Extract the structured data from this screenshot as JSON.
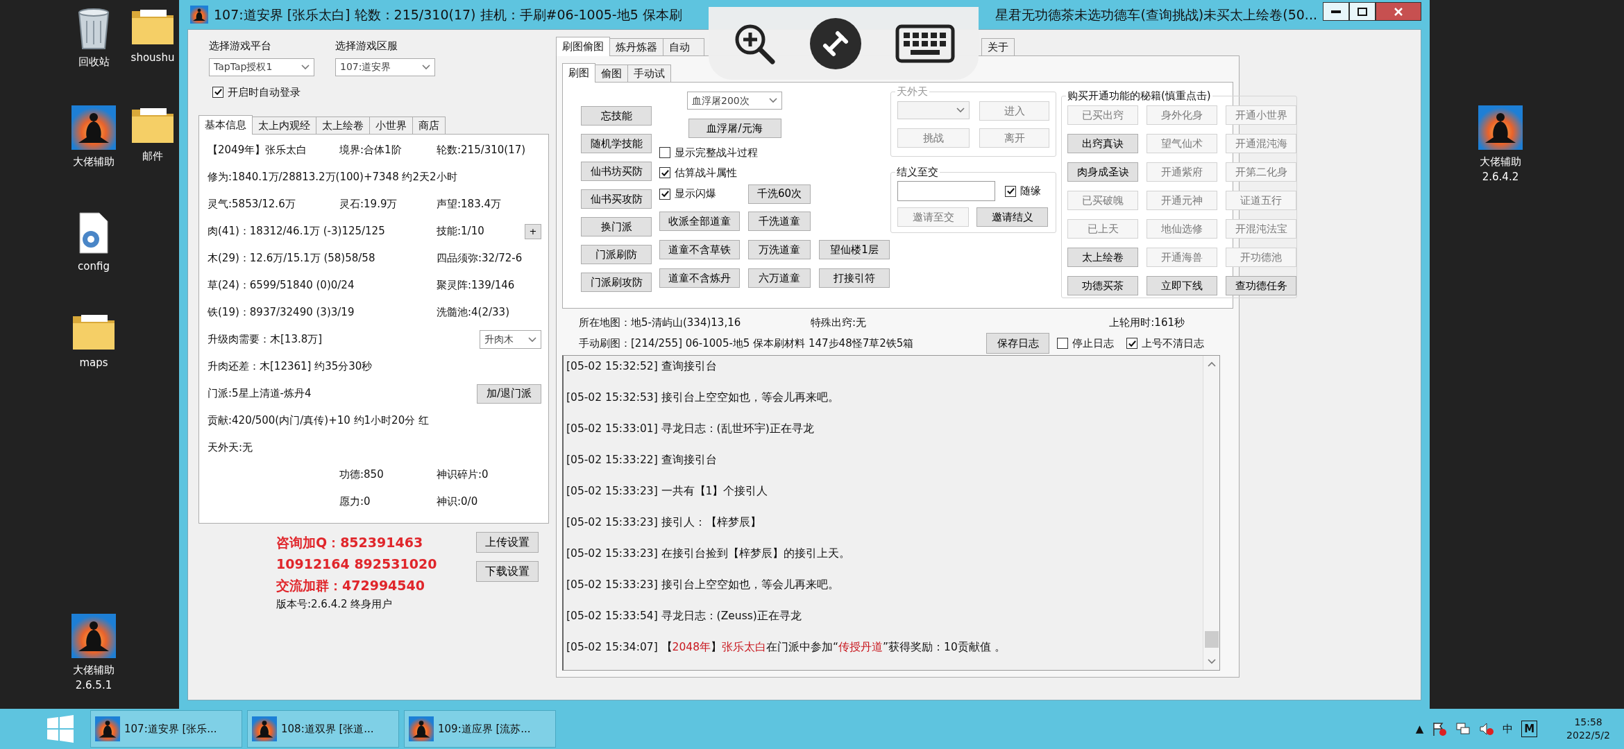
{
  "desktop_icons": [
    {
      "kind": "recycle",
      "label": "回收站"
    },
    {
      "kind": "folder",
      "label": "shoushu"
    },
    {
      "kind": "app",
      "label": "大佬辅助"
    },
    {
      "kind": "folder",
      "label": "邮件"
    },
    {
      "kind": "config",
      "label": "config"
    },
    {
      "kind": "folder",
      "label": "maps"
    },
    {
      "kind": "app",
      "label": "大佬辅助",
      "version": "2.6.5.1"
    },
    {
      "kind": "app",
      "label": "大佬辅助",
      "version": "2.6.4.2"
    }
  ],
  "window": {
    "title": "107:道安界 [张乐太白] 轮数：215/310(17) 挂机：手刷#06-1005-地5 保本刷",
    "title_end": "星君无功德茶未选功德车(查询挑战)未买太上绘卷(50..."
  },
  "login": {
    "platform_label": "选择游戏平台",
    "platform": "TapTap授权1",
    "server_label": "选择游戏区服",
    "server": "107:道安界",
    "auto_login": {
      "label": "开启时自动登录",
      "checked": true
    }
  },
  "info_tabs": [
    {
      "label": "基本信息",
      "selected": true
    },
    {
      "label": "太上内观经",
      "selected": false
    },
    {
      "label": "太上绘卷",
      "selected": false
    },
    {
      "label": "小世界",
      "selected": false
    },
    {
      "label": "商店",
      "selected": false
    }
  ],
  "info_rows": [
    {
      "left": "【2049年】张乐太白",
      "middle": "境界:合体1阶",
      "right": "轮数:215/310(17)"
    },
    {
      "full": "修为:1840.1万/28813.2万(100)+7348 约2天2小时"
    },
    {
      "left": "灵气:5853/12.6万",
      "middle": "灵石:19.9万",
      "right": "声望:183.4万"
    },
    {
      "wide": "肉(41)：18312/46.1万 (-3)125/125",
      "right": "技能:1/10",
      "button": "+"
    },
    {
      "wide": "木(29)：12.6万/15.1万 (58)58/58",
      "right": "四品须弥:32/72-6"
    },
    {
      "wide": "草(24)：6599/51840 (0)0/24",
      "right": "聚灵阵:139/146"
    },
    {
      "wide": "铁(19)：8937/32490 (3)3/19",
      "right": "洗髓池:4(2/33)"
    },
    {
      "full": "升级肉需要：木[13.8万]",
      "dropdown": "升肉木"
    },
    {
      "full": "升肉还差：木[12361] 约35分30秒"
    },
    {
      "full": "门派:5星上清道-炼丹4",
      "button": "加/退门派"
    },
    {
      "full": "贡献:420/500(内门/真传)+10 约1小时20分 红"
    },
    {
      "full": "天外天:无"
    },
    {
      "middle": "功德:850",
      "right": "神识碎片:0"
    },
    {
      "middle": "愿力:0",
      "right": "神识:0/0"
    }
  ],
  "contact_lines": [
    "咨询加Q：852391463",
    "10912164  892531020",
    "交流加群：472994540"
  ],
  "version": "版本号:2.6.4.2 终身用户",
  "side_buttons": [
    "上传设置",
    "下载设置"
  ],
  "main_tabs": [
    {
      "label": "刷图偷图",
      "selected": true
    },
    {
      "label": "炼丹炼器",
      "selected": false
    },
    {
      "label": "自动",
      "selected": false
    },
    {
      "label": "关于",
      "selected": false
    }
  ],
  "sub_tabs": [
    {
      "label": "刷图",
      "selected": true
    },
    {
      "label": "偷图",
      "selected": false
    },
    {
      "label": "手动试",
      "selected": false
    }
  ],
  "skill_buttons": [
    "忘技能",
    "随机学技能",
    "仙书坊买防",
    "仙书买攻防",
    "换门派",
    "门派刷防",
    "门派刷攻防"
  ],
  "battle_select": "血浮屠200次",
  "battle_button": "血浮屠/元海",
  "options": [
    {
      "label": "显示完整战斗过程",
      "checked": false
    },
    {
      "label": "估算战斗属性",
      "checked": true
    },
    {
      "label": "显示闪爆",
      "checked": true
    }
  ],
  "wash_button": "千洗60次",
  "action_grid": [
    [
      "收派全部道童",
      "千洗道童"
    ],
    [
      "道童不含草铁",
      "万洗道童",
      "望仙楼1层"
    ],
    [
      "道童不含炼丹",
      "六万道童",
      "打接引符"
    ]
  ],
  "tianwaitian": {
    "title": "天外天",
    "disabled": true,
    "buttons": [
      "进入",
      "挑战",
      "离开"
    ]
  },
  "jieyi": {
    "title": "结义至交",
    "random": {
      "label": "随缘",
      "checked": true
    },
    "buttons": [
      {
        "label": "邀请至交",
        "disabled": true
      },
      {
        "label": "邀请结义",
        "disabled": false
      }
    ]
  },
  "secrets": {
    "title": "购买开通功能的秘籍(慎重点击)",
    "buttons": [
      {
        "label": "已买出窍",
        "disabled": true
      },
      {
        "label": "身外化身",
        "disabled": true
      },
      {
        "label": "开通小世界",
        "disabled": true
      },
      {
        "label": "出窍真诀",
        "disabled": false
      },
      {
        "label": "望气仙术",
        "disabled": true
      },
      {
        "label": "开通混沌海",
        "disabled": true
      },
      {
        "label": "肉身成圣诀",
        "disabled": false
      },
      {
        "label": "开通紫府",
        "disabled": true
      },
      {
        "label": "开第二化身",
        "disabled": true
      },
      {
        "label": "已买破魄",
        "disabled": true
      },
      {
        "label": "开通元神",
        "disabled": true
      },
      {
        "label": "证道五行",
        "disabled": true
      },
      {
        "label": "已上天",
        "disabled": true
      },
      {
        "label": "地仙选修",
        "disabled": true
      },
      {
        "label": "开混沌法宝",
        "disabled": true
      },
      {
        "label": "太上绘卷",
        "disabled": false
      },
      {
        "label": "开通海兽",
        "disabled": true
      },
      {
        "label": "开功德池",
        "disabled": true
      },
      {
        "label": "功德买茶",
        "disabled": false
      },
      {
        "label": "立即下线",
        "disabled": false
      },
      {
        "label": "查功德任务",
        "disabled": false
      }
    ]
  },
  "status": {
    "map": "所在地图：地5-清屿山(334)13,16",
    "special": "特殊出窍:无",
    "last_round": "上轮用时:161秒",
    "manual": "手动刷图：[214/255] 06-1005-地5 保本刷材料 147步48怪7草2铁5箱"
  },
  "log_controls": {
    "save": "保存日志",
    "stop": {
      "label": "停止日志",
      "checked": false
    },
    "keep": {
      "label": "上号不清日志",
      "checked": true
    }
  },
  "log": [
    {
      "time": "[05-02 15:32:52]",
      "segments": [
        {
          "text": "查询接引台",
          "highlighted": false
        }
      ]
    },
    {
      "time": "[05-02 15:32:53]",
      "segments": [
        {
          "text": "接引台上空空如也，等会儿再来吧。",
          "highlighted": false
        }
      ]
    },
    {
      "time": "[05-02 15:33:01]",
      "segments": [
        {
          "text": "寻龙日志：(乱世环宇)正在寻龙",
          "highlighted": false
        }
      ]
    },
    {
      "time": "[05-02 15:33:22]",
      "segments": [
        {
          "text": "查询接引台",
          "highlighted": false
        }
      ]
    },
    {
      "time": "[05-02 15:33:23]",
      "segments": [
        {
          "text": "一共有【1】个接引人",
          "highlighted": false
        }
      ]
    },
    {
      "time": "[05-02 15:33:23]",
      "segments": [
        {
          "text": "接引人：【梓梦辰】",
          "highlighted": false
        }
      ]
    },
    {
      "time": "[05-02 15:33:23]",
      "segments": [
        {
          "text": "在接引台捡到【梓梦辰】的接引上天。",
          "highlighted": false
        }
      ]
    },
    {
      "time": "[05-02 15:33:23]",
      "segments": [
        {
          "text": "接引台上空空如也，等会儿再来吧。",
          "highlighted": false
        }
      ]
    },
    {
      "time": "[05-02 15:33:54]",
      "segments": [
        {
          "text": "寻龙日志：(Zeuss)正在寻龙",
          "highlighted": false
        }
      ]
    },
    {
      "time": "[05-02 15:34:07]",
      "segments": [
        {
          "text": "【",
          "highlighted": false
        },
        {
          "text": "2048年",
          "highlighted": true
        },
        {
          "text": "】",
          "highlighted": false
        },
        {
          "text": "张乐太白",
          "highlighted": true
        },
        {
          "text": "在门派中参加“",
          "highlighted": false
        },
        {
          "text": "传授丹道",
          "highlighted": true
        },
        {
          "text": "”获得奖励：10贡献值 。",
          "highlighted": false
        }
      ]
    }
  ],
  "taskbar": {
    "items": [
      "107:道安界 [张乐...",
      "108:道双界 [张道...",
      "109:道应界 [流苏..."
    ],
    "tray_arrow": "▲",
    "ime": "中",
    "ime_mode": "M",
    "time": "15:58",
    "date": "2022/5/2"
  }
}
